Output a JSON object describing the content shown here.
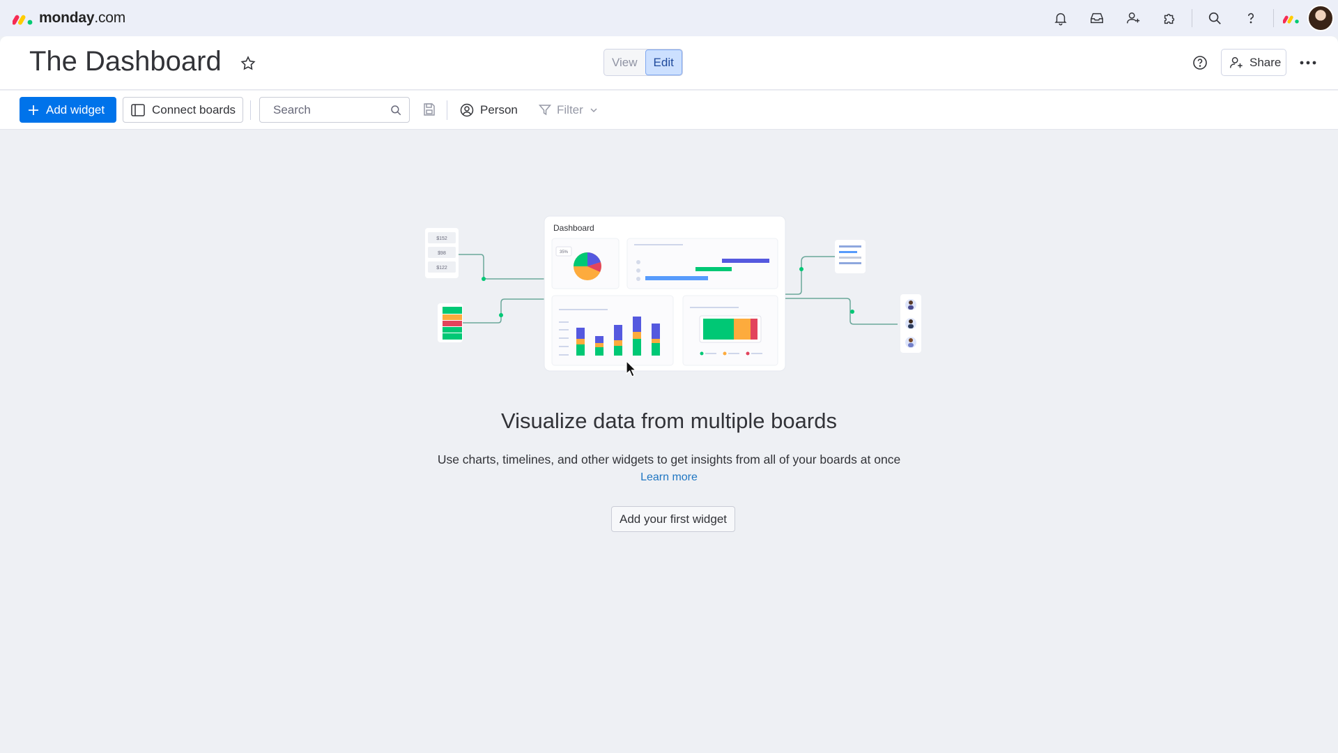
{
  "brand": {
    "name_bold": "monday",
    "name_light": ".com"
  },
  "header": {
    "title": "The Dashboard",
    "view_label": "View",
    "edit_label": "Edit",
    "share_label": "Share"
  },
  "toolbar": {
    "add_widget_label": "Add widget",
    "connect_boards_label": "Connect boards",
    "search_placeholder": "Search",
    "person_label": "Person",
    "filter_label": "Filter"
  },
  "illustration": {
    "dashboard_label": "Dashboard",
    "pie_badge": "35%",
    "stat_values": [
      "$152",
      "$98",
      "$122"
    ]
  },
  "empty_state": {
    "title": "Visualize data from multiple boards",
    "description": "Use charts, timelines, and other widgets to get insights from all of your boards at once",
    "learn_more": "Learn more",
    "cta": "Add your first widget"
  },
  "colors": {
    "primary": "#0073ea",
    "green": "#00c875",
    "yellow": "#fdab3d",
    "red": "#e2445c",
    "purple": "#5559df",
    "blue": "#579bfc"
  }
}
